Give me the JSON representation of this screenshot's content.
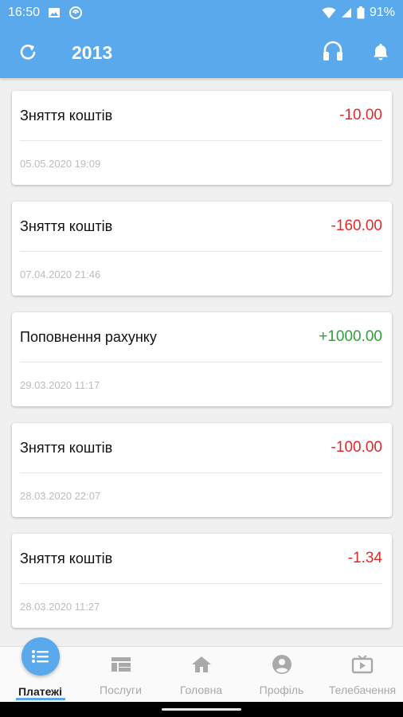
{
  "status_bar": {
    "time": "16:50",
    "battery": "91%",
    "icons": [
      "image-icon",
      "sync-status-icon",
      "wifi-icon",
      "signal-icon",
      "battery-icon"
    ]
  },
  "app_bar": {
    "title": "2013",
    "refresh_icon": "refresh-icon",
    "support_icon": "headset-icon",
    "notifications_icon": "bell-icon"
  },
  "transactions": [
    {
      "name": "Зняття коштів",
      "amount": "-10.00",
      "type": "debit",
      "date": "05.05.2020 19:09"
    },
    {
      "name": "Зняття коштів",
      "amount": "-160.00",
      "type": "debit",
      "date": "07.04.2020 21:46"
    },
    {
      "name": "Поповнення рахунку",
      "amount": "+1000.00",
      "type": "credit",
      "date": "29.03.2020 11:17"
    },
    {
      "name": "Зняття коштів",
      "amount": "-100.00",
      "type": "debit",
      "date": "28.03.2020 22:07"
    },
    {
      "name": "Зняття коштів",
      "amount": "-1.34",
      "type": "debit",
      "date": "28.03.2020 11:27"
    }
  ],
  "bottom_nav": {
    "active": "payments",
    "items": [
      {
        "key": "payments",
        "label": "Платежі",
        "icon": "list-icon"
      },
      {
        "key": "services",
        "label": "Послуги",
        "icon": "services-icon"
      },
      {
        "key": "home",
        "label": "Головна",
        "icon": "home-icon"
      },
      {
        "key": "profile",
        "label": "Профіль",
        "icon": "account-icon"
      },
      {
        "key": "tv",
        "label": "Телебачення",
        "icon": "tv-icon"
      }
    ]
  },
  "colors": {
    "primary": "#5aa9ec",
    "debit": "#e12a2a",
    "credit": "#2ea236",
    "date_text": "#bdbdbd",
    "inactive_nav": "#a9a9a9"
  }
}
